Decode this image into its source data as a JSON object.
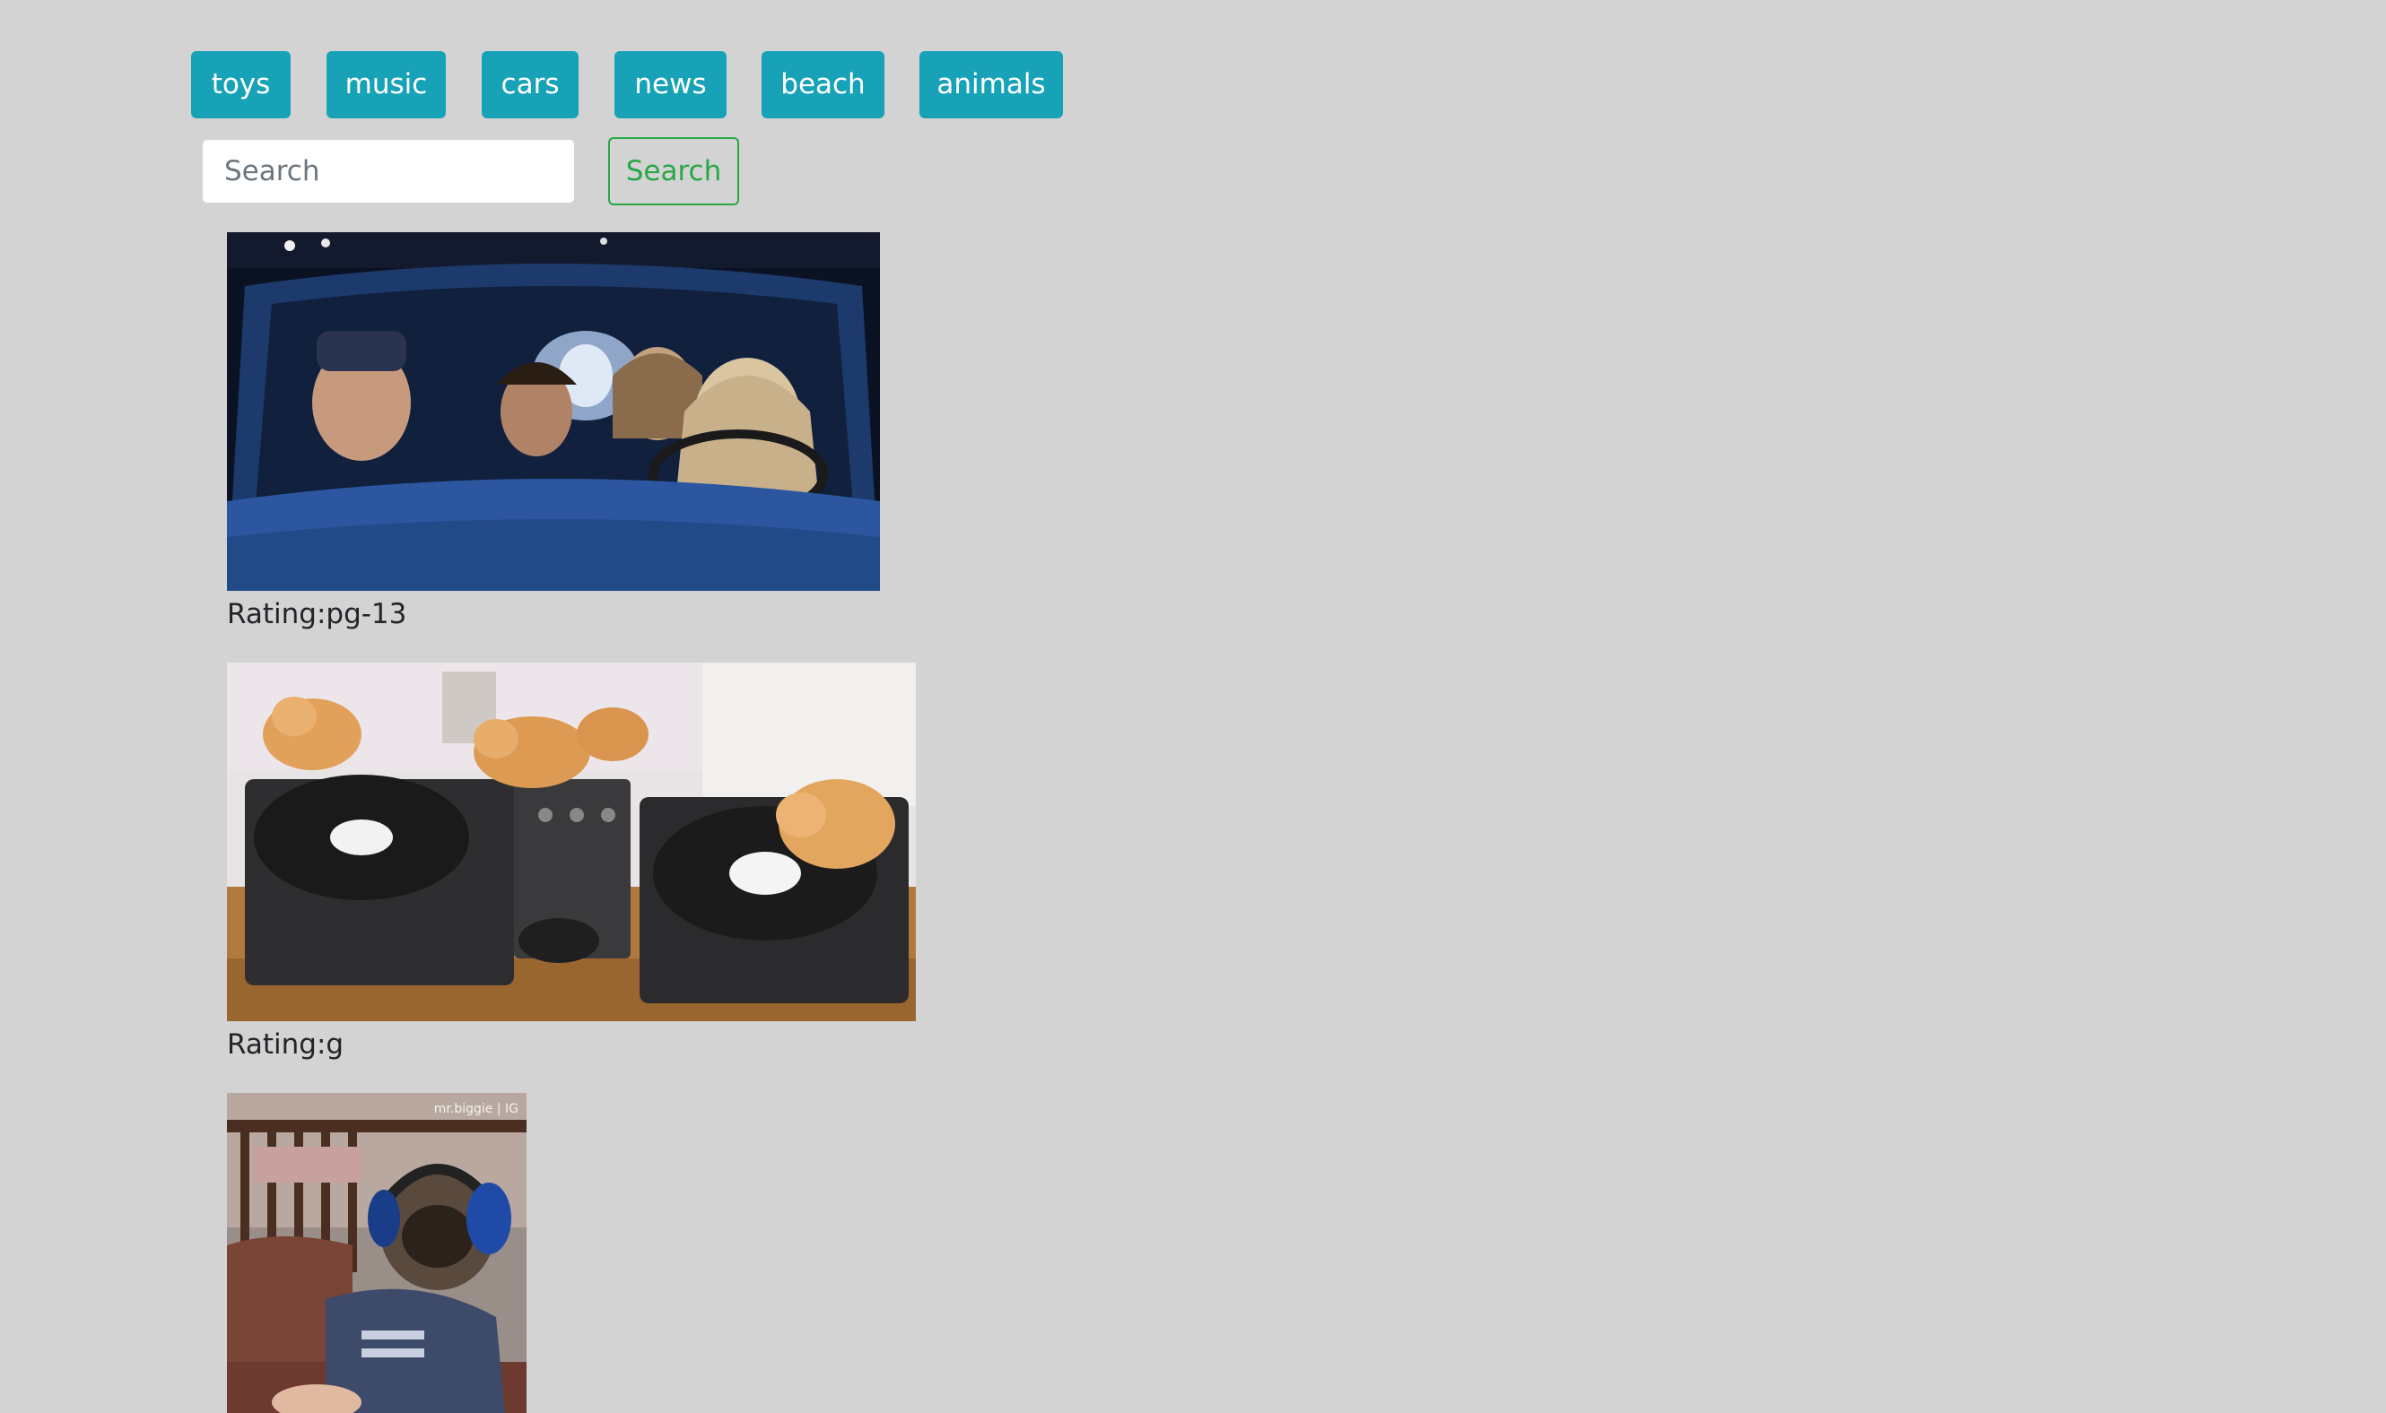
{
  "topics": [
    "toys",
    "music",
    "cars",
    "news",
    "beach",
    "animals"
  ],
  "search": {
    "placeholder": "Search",
    "value": "",
    "button_label": "Search"
  },
  "gifs": [
    {
      "rating_label": "Rating:pg-13"
    },
    {
      "rating_label": "Rating:g"
    },
    {
      "rating_label": "",
      "watermark": "mr.biggie | IG"
    }
  ],
  "colors": {
    "background": "#d3d3d3",
    "topic_button": "#17a2b8",
    "search_button_outline": "#28a745"
  }
}
